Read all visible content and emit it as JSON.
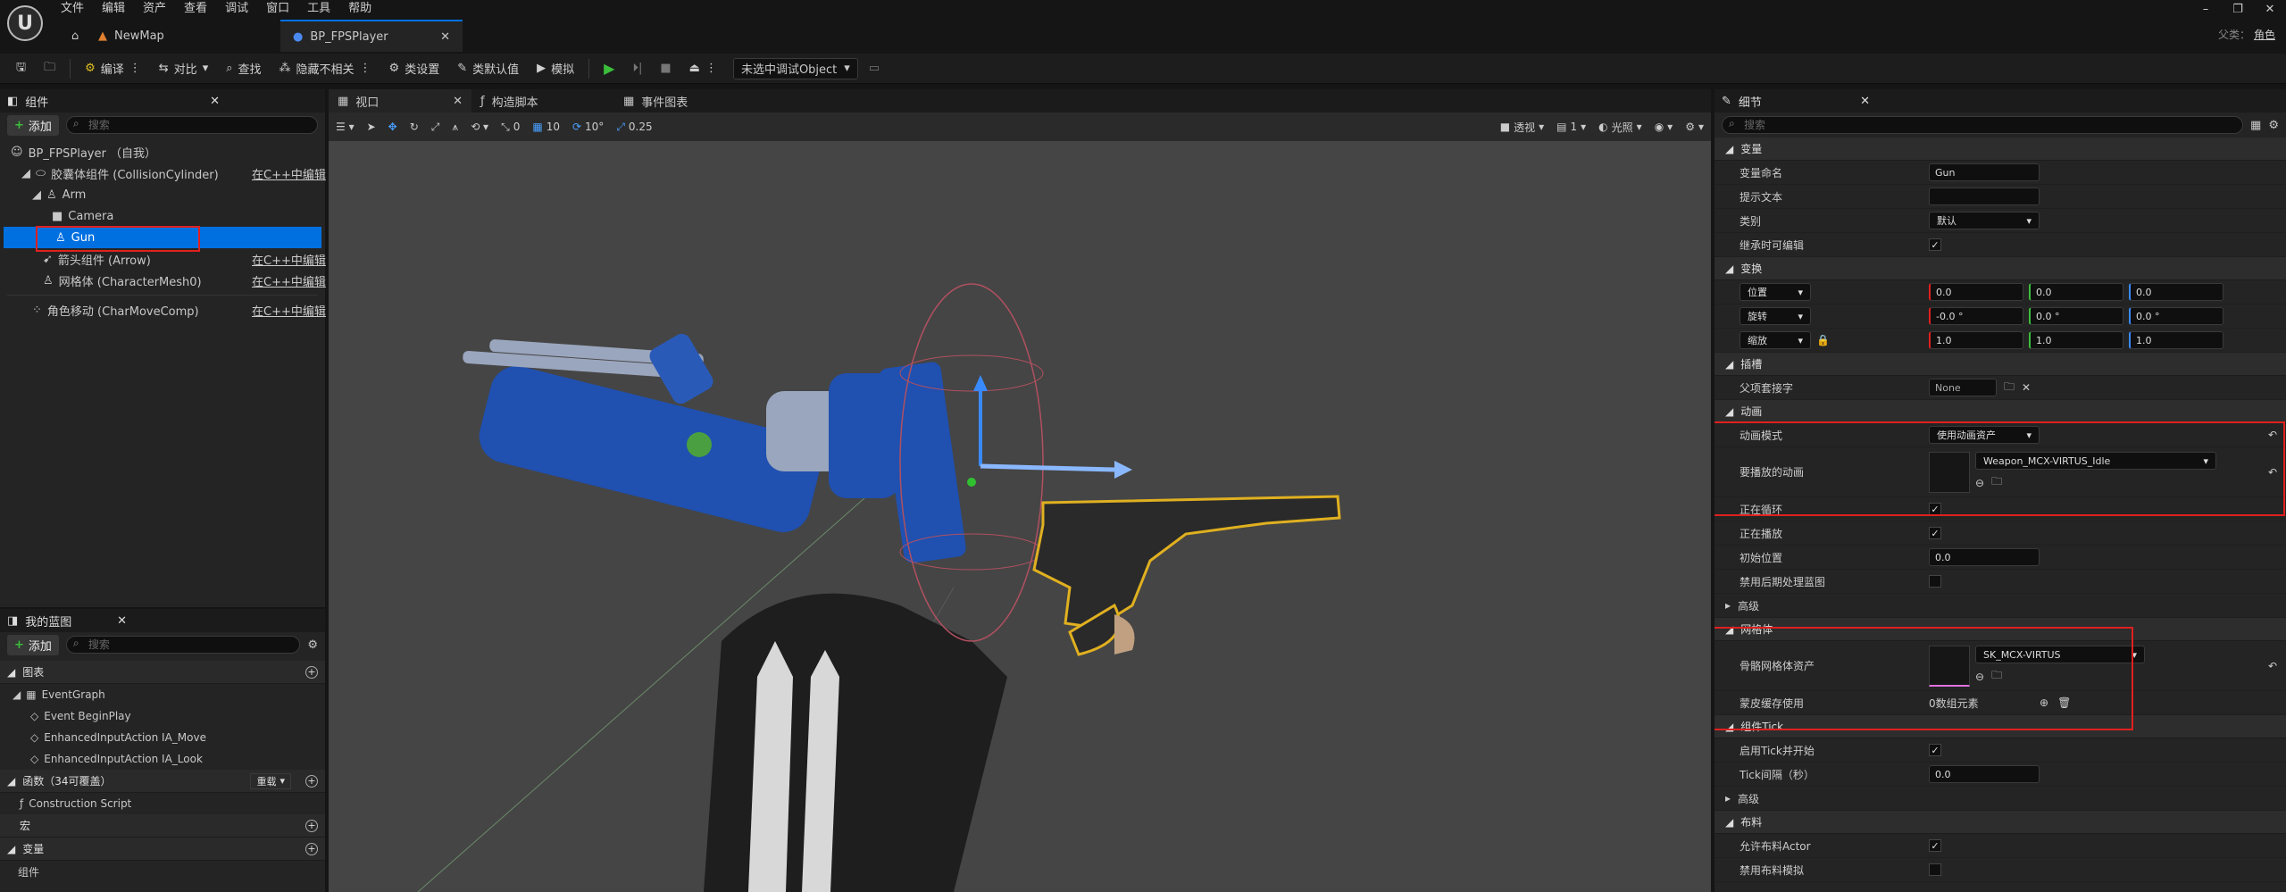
{
  "menu": [
    "文件",
    "编辑",
    "资产",
    "查看",
    "调试",
    "窗口",
    "工具",
    "帮助"
  ],
  "tabs": [
    {
      "label": "NewMap"
    },
    {
      "label": "BP_FPSPlayer"
    }
  ],
  "parent_label": "父类：",
  "parent_value": "角色",
  "toolbar": {
    "compile": "编译",
    "diff": "对比",
    "find": "查找",
    "hide_unrelated": "隐藏不相关",
    "class_settings": "类设置",
    "class_defaults": "类默认值",
    "simulate": "模拟",
    "debug_object": "未选中调试Object"
  },
  "components": {
    "title": "组件",
    "add": "添加",
    "search_placeholder": "搜索",
    "items": [
      {
        "label": "BP_FPSPlayer （自我）"
      },
      {
        "label": "胶囊体组件 (CollisionCylinder)",
        "edit": "在C++中编辑"
      },
      {
        "label": "Arm"
      },
      {
        "label": "Camera"
      },
      {
        "label": "Gun"
      },
      {
        "label": "箭头组件 (Arrow)",
        "edit": "在C++中编辑"
      },
      {
        "label": "网格体 (CharacterMesh0)",
        "edit": "在C++中编辑"
      },
      {
        "label": "角色移动 (CharMoveComp)",
        "edit": "在C++中编辑"
      }
    ]
  },
  "my_blueprint": {
    "title": "我的蓝图",
    "add": "添加",
    "search_placeholder": "搜索",
    "graphs_label": "图表",
    "event_graph": "EventGraph",
    "events": [
      "Event BeginPlay",
      "EnhancedInputAction IA_Move",
      "EnhancedInputAction IA_Look"
    ],
    "functions_label": "函数（34可覆盖）",
    "override": "重载",
    "construction": "Construction Script",
    "macros": "宏",
    "variables": "变量",
    "components_sub": "组件"
  },
  "center_tabs": [
    "视口",
    "构造脚本",
    "事件图表"
  ],
  "viewport": {
    "snap_angle": "0",
    "grid": "10",
    "rot": "10°",
    "scale": "0.25",
    "perspective": "透视",
    "lit": "光照",
    "count": "1"
  },
  "details": {
    "title": "细节",
    "search_placeholder": "搜索",
    "sections": {
      "variable": "变量",
      "transform": "变换",
      "sockets": "插槽",
      "animation": "动画",
      "advanced": "高级",
      "mesh": "网格体",
      "tick": "组件Tick",
      "advanced2": "高级",
      "cloth": "布料"
    },
    "var_name_label": "变量命名",
    "var_name": "Gun",
    "tooltip_label": "提示文本",
    "category_label": "类别",
    "category": "默认",
    "editable_label": "继承时可编辑",
    "location": "位置",
    "rotation": "旋转",
    "scale": "缩放",
    "loc": [
      "0.0",
      "0.0",
      "0.0"
    ],
    "rot": [
      "-0.0 °",
      "0.0 °",
      "0.0 °"
    ],
    "scl": [
      "1.0",
      "1.0",
      "1.0"
    ],
    "parent_socket_label": "父项套接字",
    "parent_socket": "None",
    "anim_mode_label": "动画模式",
    "anim_mode": "使用动画资产",
    "anim_play_label": "要播放的动画",
    "anim_asset": "Weapon_MCX-VIRTUS_Idle",
    "looping_label": "正在循环",
    "playing_label": "正在播放",
    "init_pos_label": "初始位置",
    "init_pos": "0.0",
    "disable_post_label": "禁用后期处理蓝图",
    "skel_mesh_label": "骨骼网格体资产",
    "skel_mesh": "SK_MCX-VIRTUS",
    "skin_cache_label": "蒙皮缓存使用",
    "skin_cache": "0数组元素",
    "tick_start_label": "启用Tick并开始",
    "tick_interval_label": "Tick间隔（秒）",
    "tick_interval": "0.0",
    "allow_cloth_label": "允许布料Actor",
    "disable_cloth_label": "禁用布料模拟"
  },
  "colors": {
    "accent": "#0070e0",
    "red": "#e02020",
    "green": "#3bbf3b"
  }
}
